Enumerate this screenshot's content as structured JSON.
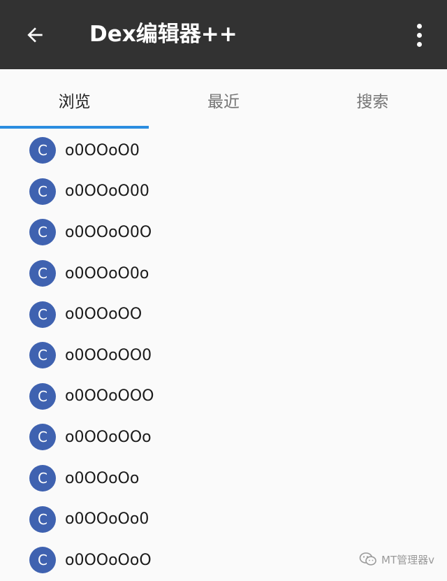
{
  "app_bar": {
    "title": "Dex编辑器++",
    "back_icon": "arrow-left-icon",
    "more_icon": "more-vert-icon",
    "background": "#323232"
  },
  "tabs": [
    {
      "label": "浏览",
      "active": true
    },
    {
      "label": "最近",
      "active": false
    },
    {
      "label": "搜索",
      "active": false
    }
  ],
  "accent_color": "#2b8de0",
  "badge_color": "#3f62b0",
  "list": {
    "items": [
      {
        "badge": "C",
        "label": "o0OOoO0"
      },
      {
        "badge": "C",
        "label": "o0OOoO00"
      },
      {
        "badge": "C",
        "label": "o0OOoO0O"
      },
      {
        "badge": "C",
        "label": "o0OOoO0o"
      },
      {
        "badge": "C",
        "label": "o0OOoOO"
      },
      {
        "badge": "C",
        "label": "o0OOoOO0"
      },
      {
        "badge": "C",
        "label": "o0OOoOOO"
      },
      {
        "badge": "C",
        "label": "o0OOoOOo"
      },
      {
        "badge": "C",
        "label": "o0OOoOo"
      },
      {
        "badge": "C",
        "label": "o0OOoOo0"
      },
      {
        "badge": "C",
        "label": "o0OOoOoO"
      }
    ]
  },
  "watermark": {
    "icon": "wechat-icon",
    "text": "MT管理器v"
  }
}
